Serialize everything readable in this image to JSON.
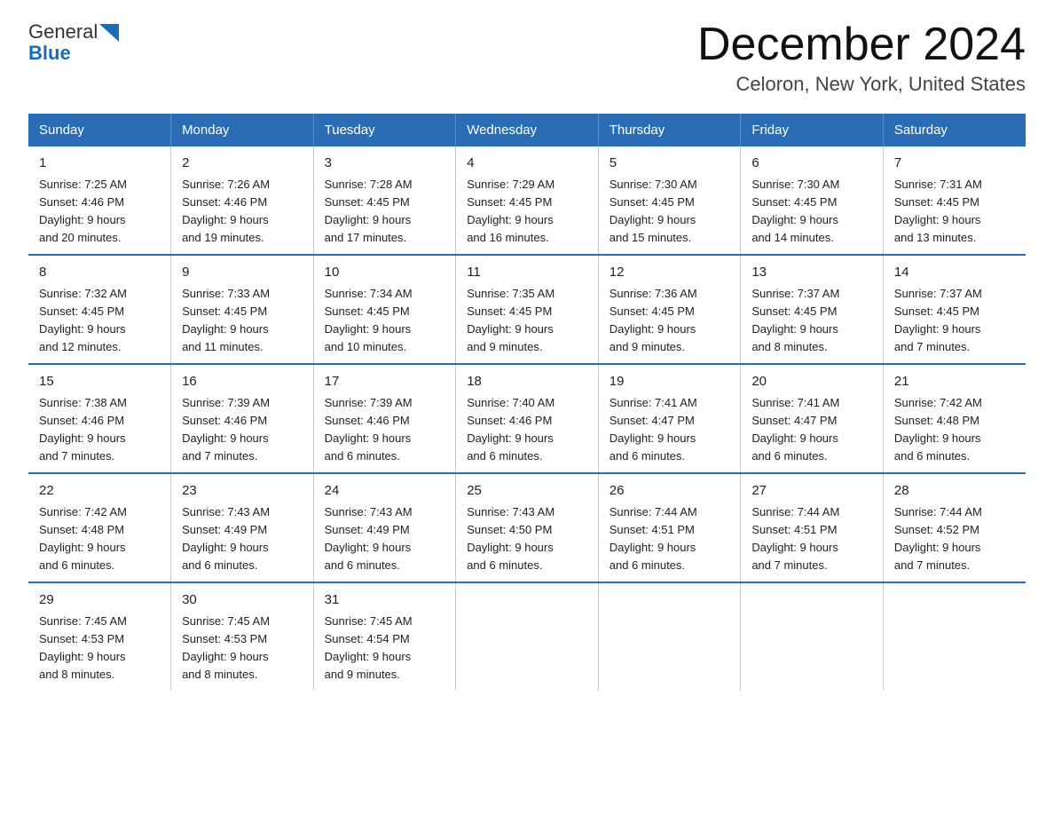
{
  "logo": {
    "general": "General",
    "blue": "Blue",
    "triangle": "▶"
  },
  "title": "December 2024",
  "location": "Celoron, New York, United States",
  "days_of_week": [
    "Sunday",
    "Monday",
    "Tuesday",
    "Wednesday",
    "Thursday",
    "Friday",
    "Saturday"
  ],
  "weeks": [
    [
      {
        "day": "1",
        "sunrise": "7:25 AM",
        "sunset": "4:46 PM",
        "daylight": "9 hours and 20 minutes."
      },
      {
        "day": "2",
        "sunrise": "7:26 AM",
        "sunset": "4:46 PM",
        "daylight": "9 hours and 19 minutes."
      },
      {
        "day": "3",
        "sunrise": "7:28 AM",
        "sunset": "4:45 PM",
        "daylight": "9 hours and 17 minutes."
      },
      {
        "day": "4",
        "sunrise": "7:29 AM",
        "sunset": "4:45 PM",
        "daylight": "9 hours and 16 minutes."
      },
      {
        "day": "5",
        "sunrise": "7:30 AM",
        "sunset": "4:45 PM",
        "daylight": "9 hours and 15 minutes."
      },
      {
        "day": "6",
        "sunrise": "7:30 AM",
        "sunset": "4:45 PM",
        "daylight": "9 hours and 14 minutes."
      },
      {
        "day": "7",
        "sunrise": "7:31 AM",
        "sunset": "4:45 PM",
        "daylight": "9 hours and 13 minutes."
      }
    ],
    [
      {
        "day": "8",
        "sunrise": "7:32 AM",
        "sunset": "4:45 PM",
        "daylight": "9 hours and 12 minutes."
      },
      {
        "day": "9",
        "sunrise": "7:33 AM",
        "sunset": "4:45 PM",
        "daylight": "9 hours and 11 minutes."
      },
      {
        "day": "10",
        "sunrise": "7:34 AM",
        "sunset": "4:45 PM",
        "daylight": "9 hours and 10 minutes."
      },
      {
        "day": "11",
        "sunrise": "7:35 AM",
        "sunset": "4:45 PM",
        "daylight": "9 hours and 9 minutes."
      },
      {
        "day": "12",
        "sunrise": "7:36 AM",
        "sunset": "4:45 PM",
        "daylight": "9 hours and 9 minutes."
      },
      {
        "day": "13",
        "sunrise": "7:37 AM",
        "sunset": "4:45 PM",
        "daylight": "9 hours and 8 minutes."
      },
      {
        "day": "14",
        "sunrise": "7:37 AM",
        "sunset": "4:45 PM",
        "daylight": "9 hours and 7 minutes."
      }
    ],
    [
      {
        "day": "15",
        "sunrise": "7:38 AM",
        "sunset": "4:46 PM",
        "daylight": "9 hours and 7 minutes."
      },
      {
        "day": "16",
        "sunrise": "7:39 AM",
        "sunset": "4:46 PM",
        "daylight": "9 hours and 7 minutes."
      },
      {
        "day": "17",
        "sunrise": "7:39 AM",
        "sunset": "4:46 PM",
        "daylight": "9 hours and 6 minutes."
      },
      {
        "day": "18",
        "sunrise": "7:40 AM",
        "sunset": "4:46 PM",
        "daylight": "9 hours and 6 minutes."
      },
      {
        "day": "19",
        "sunrise": "7:41 AM",
        "sunset": "4:47 PM",
        "daylight": "9 hours and 6 minutes."
      },
      {
        "day": "20",
        "sunrise": "7:41 AM",
        "sunset": "4:47 PM",
        "daylight": "9 hours and 6 minutes."
      },
      {
        "day": "21",
        "sunrise": "7:42 AM",
        "sunset": "4:48 PM",
        "daylight": "9 hours and 6 minutes."
      }
    ],
    [
      {
        "day": "22",
        "sunrise": "7:42 AM",
        "sunset": "4:48 PM",
        "daylight": "9 hours and 6 minutes."
      },
      {
        "day": "23",
        "sunrise": "7:43 AM",
        "sunset": "4:49 PM",
        "daylight": "9 hours and 6 minutes."
      },
      {
        "day": "24",
        "sunrise": "7:43 AM",
        "sunset": "4:49 PM",
        "daylight": "9 hours and 6 minutes."
      },
      {
        "day": "25",
        "sunrise": "7:43 AM",
        "sunset": "4:50 PM",
        "daylight": "9 hours and 6 minutes."
      },
      {
        "day": "26",
        "sunrise": "7:44 AM",
        "sunset": "4:51 PM",
        "daylight": "9 hours and 6 minutes."
      },
      {
        "day": "27",
        "sunrise": "7:44 AM",
        "sunset": "4:51 PM",
        "daylight": "9 hours and 7 minutes."
      },
      {
        "day": "28",
        "sunrise": "7:44 AM",
        "sunset": "4:52 PM",
        "daylight": "9 hours and 7 minutes."
      }
    ],
    [
      {
        "day": "29",
        "sunrise": "7:45 AM",
        "sunset": "4:53 PM",
        "daylight": "9 hours and 8 minutes."
      },
      {
        "day": "30",
        "sunrise": "7:45 AM",
        "sunset": "4:53 PM",
        "daylight": "9 hours and 8 minutes."
      },
      {
        "day": "31",
        "sunrise": "7:45 AM",
        "sunset": "4:54 PM",
        "daylight": "9 hours and 9 minutes."
      },
      null,
      null,
      null,
      null
    ]
  ],
  "labels": {
    "sunrise": "Sunrise:",
    "sunset": "Sunset:",
    "daylight": "Daylight:"
  }
}
